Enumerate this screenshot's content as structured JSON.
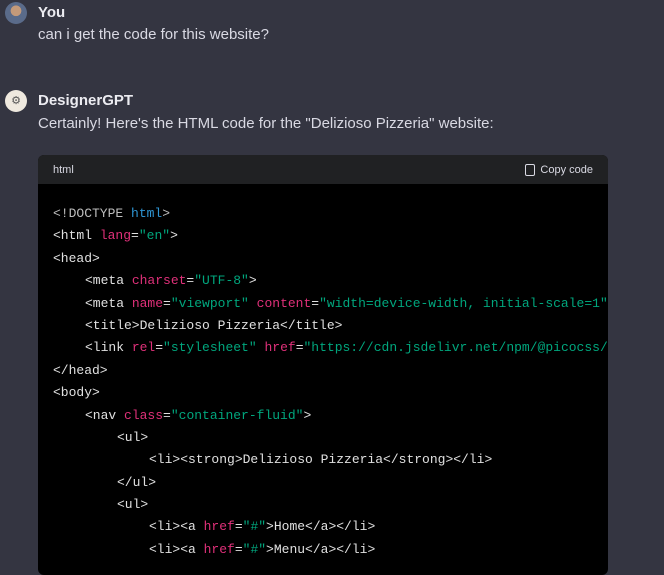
{
  "user": {
    "name": "You",
    "message": "can i get the code for this website?"
  },
  "assistant": {
    "name": "DesignerGPT",
    "message": "Certainly! Here's the HTML code for the \"Delizioso Pizzeria\" website:"
  },
  "code_block": {
    "language": "html",
    "copy_label": "Copy code",
    "lines": [
      [
        0,
        [
          [
            "d",
            "<!DOCTYPE "
          ],
          [
            "k",
            "html"
          ],
          [
            "d",
            ">"
          ]
        ]
      ],
      [
        0,
        [
          [
            "t",
            "<html "
          ],
          [
            "a",
            "lang"
          ],
          [
            "t",
            "="
          ],
          [
            "s",
            "\"en\""
          ],
          [
            "t",
            ">"
          ]
        ]
      ],
      [
        0,
        [
          [
            "t",
            "<head>"
          ]
        ]
      ],
      [
        1,
        [
          [
            "t",
            "<meta "
          ],
          [
            "a",
            "charset"
          ],
          [
            "t",
            "="
          ],
          [
            "s",
            "\"UTF-8\""
          ],
          [
            "t",
            ">"
          ]
        ]
      ],
      [
        1,
        [
          [
            "t",
            "<meta "
          ],
          [
            "a",
            "name"
          ],
          [
            "t",
            "="
          ],
          [
            "s",
            "\"viewport\""
          ],
          [
            "t",
            " "
          ],
          [
            "a",
            "content"
          ],
          [
            "t",
            "="
          ],
          [
            "s",
            "\"width=device-width, initial-scale=1\""
          ]
        ]
      ],
      [
        1,
        [
          [
            "t",
            "<title>Delizioso Pizzeria</title>"
          ]
        ]
      ],
      [
        1,
        [
          [
            "t",
            "<link "
          ],
          [
            "a",
            "rel"
          ],
          [
            "t",
            "="
          ],
          [
            "s",
            "\"stylesheet\""
          ],
          [
            "t",
            " "
          ],
          [
            "a",
            "href"
          ],
          [
            "t",
            "="
          ],
          [
            "s",
            "\"https://cdn.jsdelivr.net/npm/@picocss/"
          ]
        ]
      ],
      [
        0,
        [
          [
            "t",
            "</head>"
          ]
        ]
      ],
      [
        0,
        [
          [
            "t",
            "<body>"
          ]
        ]
      ],
      [
        1,
        [
          [
            "t",
            "<nav "
          ],
          [
            "a",
            "class"
          ],
          [
            "t",
            "="
          ],
          [
            "s",
            "\"container-fluid\""
          ],
          [
            "t",
            ">"
          ]
        ]
      ],
      [
        2,
        [
          [
            "t",
            "<ul>"
          ]
        ]
      ],
      [
        3,
        [
          [
            "t",
            "<li><strong>Delizioso Pizzeria</strong></li>"
          ]
        ]
      ],
      [
        2,
        [
          [
            "t",
            "</ul>"
          ]
        ]
      ],
      [
        2,
        [
          [
            "t",
            "<ul>"
          ]
        ]
      ],
      [
        3,
        [
          [
            "t",
            "<li><a "
          ],
          [
            "a",
            "href"
          ],
          [
            "t",
            "="
          ],
          [
            "s",
            "\"#\""
          ],
          [
            "t",
            ">Home</a></li>"
          ]
        ]
      ],
      [
        3,
        [
          [
            "t",
            "<li><a "
          ],
          [
            "a",
            "href"
          ],
          [
            "t",
            "="
          ],
          [
            "s",
            "\"#\""
          ],
          [
            "t",
            ">Menu</a></li>"
          ]
        ]
      ]
    ]
  }
}
